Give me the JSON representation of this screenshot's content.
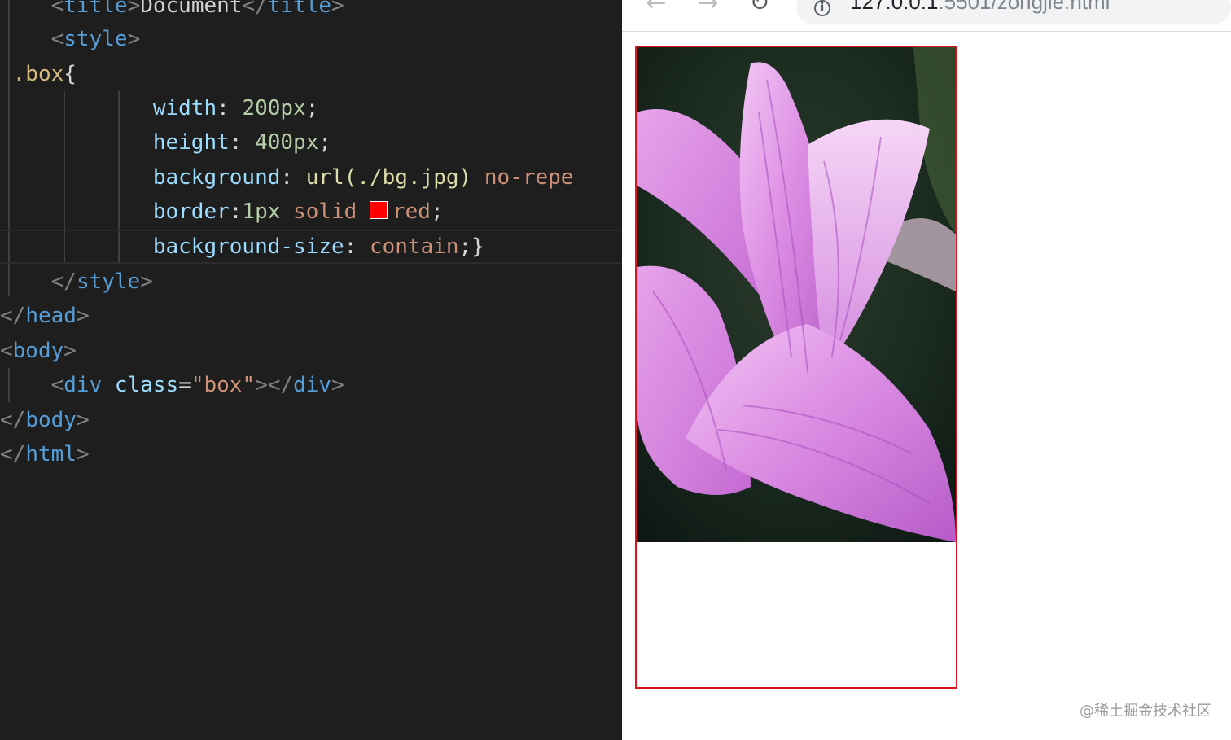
{
  "editor": {
    "lines": [
      {
        "open": "<",
        "tag": "title",
        "close": ">",
        "text": "Document",
        "open2": "</",
        "tag2": "title",
        "close2": ">"
      },
      {
        "open": "<",
        "tag": "style",
        "close": ">"
      },
      {
        "selector": ".box",
        "brace": "{"
      },
      {
        "prop": "width",
        "sep": ": ",
        "num": "200px",
        "end": ";"
      },
      {
        "prop": "height",
        "sep": ": ",
        "num": "400px",
        "end": ";"
      },
      {
        "prop": "background",
        "sep": ": ",
        "func": "url",
        "args": "(./bg.jpg)",
        "val": "no-repe"
      },
      {
        "prop": "border",
        "sep": ":",
        "num": "1px",
        "val": "solid",
        "val2": "red",
        "end": ";"
      },
      {
        "prop": "background-size",
        "sep": ": ",
        "val": "contain",
        "end": ";}"
      },
      {
        "open": "</",
        "tag": "style",
        "close": ">"
      },
      {
        "open": "</",
        "tag": "head",
        "close": ">"
      },
      {
        "open": "<",
        "tag": "body",
        "close": ">"
      },
      {
        "open": "<",
        "tag": "div",
        "attr": "class",
        "eq": "=",
        "str": "\"box\"",
        "close": ">",
        "open2": "</",
        "tag2": "div",
        "close2": ">"
      },
      {
        "open": "</",
        "tag": "body",
        "close": ">"
      },
      {
        "open": "</",
        "tag": "html",
        "close": ">"
      }
    ],
    "swatch_color": "#ff0000"
  },
  "browser": {
    "back_icon": "←",
    "forward_icon": "→",
    "reload_icon": "↻",
    "info_icon": "i",
    "url_host": "127.0.0.1",
    "url_path": ":5501/zongjie.html",
    "box_border_color": "#e0141e",
    "image_name": "bg.jpg"
  },
  "watermark": "@稀土掘金技术社区"
}
